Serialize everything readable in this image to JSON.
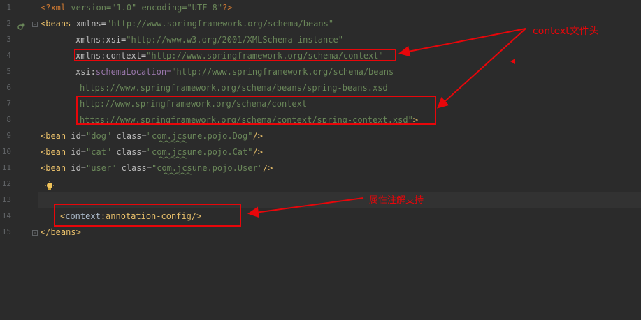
{
  "editor": {
    "line_numbers": [
      "1",
      "2",
      "3",
      "4",
      "5",
      "6",
      "7",
      "8",
      "9",
      "10",
      "11",
      "12",
      "13",
      "14",
      "15"
    ],
    "lines": {
      "l1": {
        "p1": "<?",
        "p2": "xml",
        "p3": " version=\"1.0\" encoding=\"UTF-8\"",
        "p4": "?>"
      },
      "l2": {
        "p1": "<beans ",
        "p2": "xmlns=",
        "p3": "\"http://www.springframework.org/schema/beans\""
      },
      "l3": {
        "p1": "xmlns:",
        "p2": "xsi=",
        "p3": "\"http://www.w3.org/2001/XMLSchema-instance\""
      },
      "l4": {
        "p1": "xmlns:",
        "p2": "context=",
        "p3": "\"http://www.springframework.org/schema/context\""
      },
      "l5": {
        "p1": "xsi:",
        "p2": "schemaLocation=",
        "p3": "\"http://www.springframework.org/schema/beans"
      },
      "l6": {
        "p1": "https://www.springframework.org/schema/beans/spring-beans.xsd"
      },
      "l7": {
        "p1": "http://www.springframework.org/schema/context"
      },
      "l8": {
        "p1": "https://www.springframework.org/schema/context/spring-context.xsd\"",
        "p2": ">"
      },
      "l9": {
        "p1": "<bean ",
        "p2": "id=",
        "p3": "\"dog\" ",
        "p4": "class=",
        "p5": "\"com.jcsune.pojo.Dog\"",
        "p6": "/>"
      },
      "l10": {
        "p1": "<bean ",
        "p2": "id=",
        "p3": "\"cat\" ",
        "p4": "class=",
        "p5": "\"com.jcsune.pojo.Cat\"",
        "p6": "/>"
      },
      "l11": {
        "p1": "<bean ",
        "p2": "id=",
        "p3": "\"user\" ",
        "p4": "class=",
        "p5": "\"com.jcsune.pojo.User\"",
        "p6": "/>"
      },
      "l14": {
        "p1": "<",
        "p2": "context",
        "p3": ":annotation-config",
        "p4": "/>"
      },
      "l15": {
        "p1": "</beans>"
      }
    }
  },
  "annotations": {
    "note1": "context文件头",
    "note2": "属性注解支持"
  },
  "colors": {
    "accent": "#e8060a",
    "background": "#2b2b2b",
    "current_line": "#323232"
  }
}
